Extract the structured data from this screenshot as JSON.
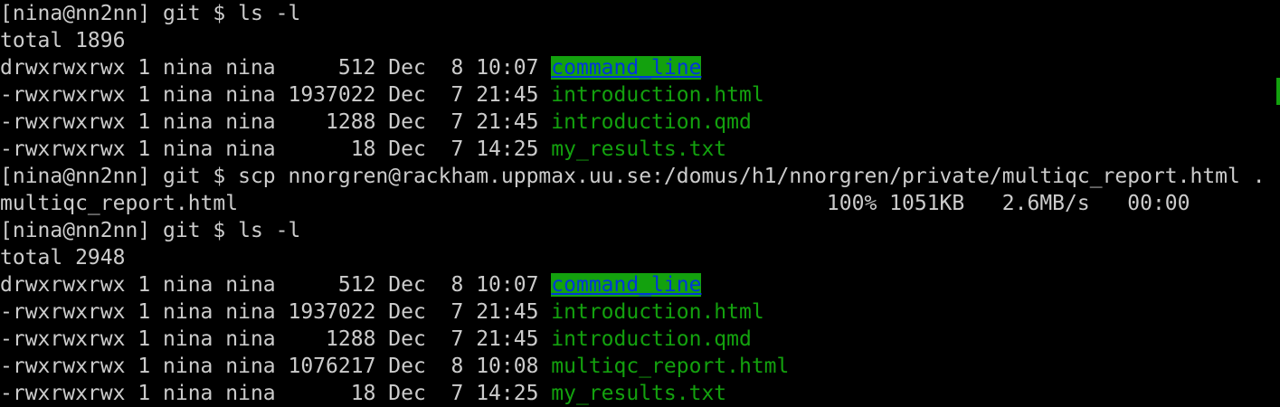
{
  "terminal": {
    "lines": [
      {
        "type": "prompt",
        "text": "[nina@nn2nn] git $ ls -l"
      },
      {
        "type": "plain",
        "text": "total 1896"
      },
      {
        "type": "entry",
        "meta": "drwxrwxrwx 1 nina nina     512 Dec  8 10:07 ",
        "name": "command_line",
        "kind": "dir"
      },
      {
        "type": "entry",
        "meta": "-rwxrwxrwx 1 nina nina 1937022 Dec  7 21:45 ",
        "name": "introduction.html",
        "kind": "file"
      },
      {
        "type": "entry",
        "meta": "-rwxrwxrwx 1 nina nina    1288 Dec  7 21:45 ",
        "name": "introduction.qmd",
        "kind": "file"
      },
      {
        "type": "entry",
        "meta": "-rwxrwxrwx 1 nina nina      18 Dec  7 14:25 ",
        "name": "my_results.txt",
        "kind": "file"
      },
      {
        "type": "prompt",
        "text": "[nina@nn2nn] git $ scp nnorgren@rackham.uppmax.uu.se:/domus/h1/nnorgren/private/multiqc_report.html ."
      },
      {
        "type": "plain",
        "text": "multiqc_report.html                                               100% 1051KB   2.6MB/s   00:00"
      },
      {
        "type": "prompt",
        "text": "[nina@nn2nn] git $ ls -l"
      },
      {
        "type": "plain",
        "text": "total 2948"
      },
      {
        "type": "entry",
        "meta": "drwxrwxrwx 1 nina nina     512 Dec  8 10:07 ",
        "name": "command_line",
        "kind": "dir"
      },
      {
        "type": "entry",
        "meta": "-rwxrwxrwx 1 nina nina 1937022 Dec  7 21:45 ",
        "name": "introduction.html",
        "kind": "file"
      },
      {
        "type": "entry",
        "meta": "-rwxrwxrwx 1 nina nina    1288 Dec  7 21:45 ",
        "name": "introduction.qmd",
        "kind": "file"
      },
      {
        "type": "entry",
        "meta": "-rwxrwxrwx 1 nina nina 1076217 Dec  8 10:08 ",
        "name": "multiqc_report.html",
        "kind": "file"
      },
      {
        "type": "entry",
        "meta": "-rwxrwxrwx 1 nina nina      18 Dec  7 14:25 ",
        "name": "my_results.txt",
        "kind": "file"
      }
    ]
  },
  "colors": {
    "background": "#000000",
    "text": "#cccccc",
    "file": "#13a10e",
    "dir_fg": "#0037da",
    "dir_bg": "#13a10e"
  }
}
